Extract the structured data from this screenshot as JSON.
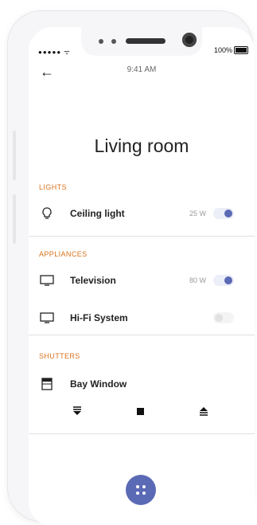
{
  "status_bar": {
    "time": "9:41 AM",
    "battery": "100%"
  },
  "header": {
    "back_icon": "arrow-left-icon",
    "title": "Living room"
  },
  "sections": {
    "lights": {
      "label": "LIGHTS",
      "items": [
        {
          "icon": "light-bulb-icon",
          "name": "Ceiling light",
          "power": "25 W",
          "on": true
        }
      ]
    },
    "appliances": {
      "label": "APPLIANCES",
      "items": [
        {
          "icon": "monitor-icon",
          "name": "Television",
          "power": "80 W",
          "on": true
        },
        {
          "icon": "monitor-icon",
          "name": "Hi-Fi System",
          "power": "",
          "on": false
        }
      ]
    },
    "shutters": {
      "label": "SHUTTERS",
      "items": [
        {
          "icon": "window-shutter-icon",
          "name": "Bay Window"
        }
      ],
      "controls": [
        "shutter-down-icon",
        "stop-icon",
        "shutter-up-icon"
      ]
    }
  },
  "fab": {
    "icon": "grid-dots-icon"
  },
  "colors": {
    "accent": "#5b6ab5",
    "section_label": "#d9721b"
  }
}
